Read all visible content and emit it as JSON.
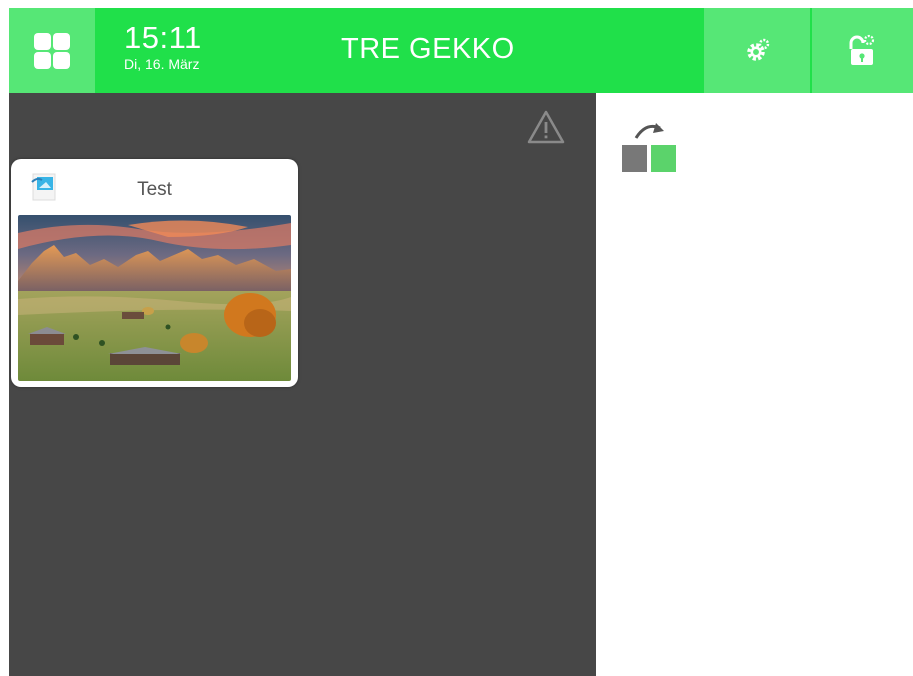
{
  "header": {
    "time": "15:11",
    "date": "Di, 16. März",
    "title": "TRE GEKKO",
    "colors": {
      "bar": "#20e04a",
      "button": "#56e776"
    }
  },
  "icons": {
    "home": "grid-menu-icon",
    "settings": "gear-icon",
    "lock": "unlock-icon",
    "warning": "warning-triangle-icon",
    "card": "image-file-icon",
    "sidebar": "transfer-blocks-icon"
  },
  "card": {
    "title": "Test",
    "image": "mountain-landscape-photo"
  }
}
